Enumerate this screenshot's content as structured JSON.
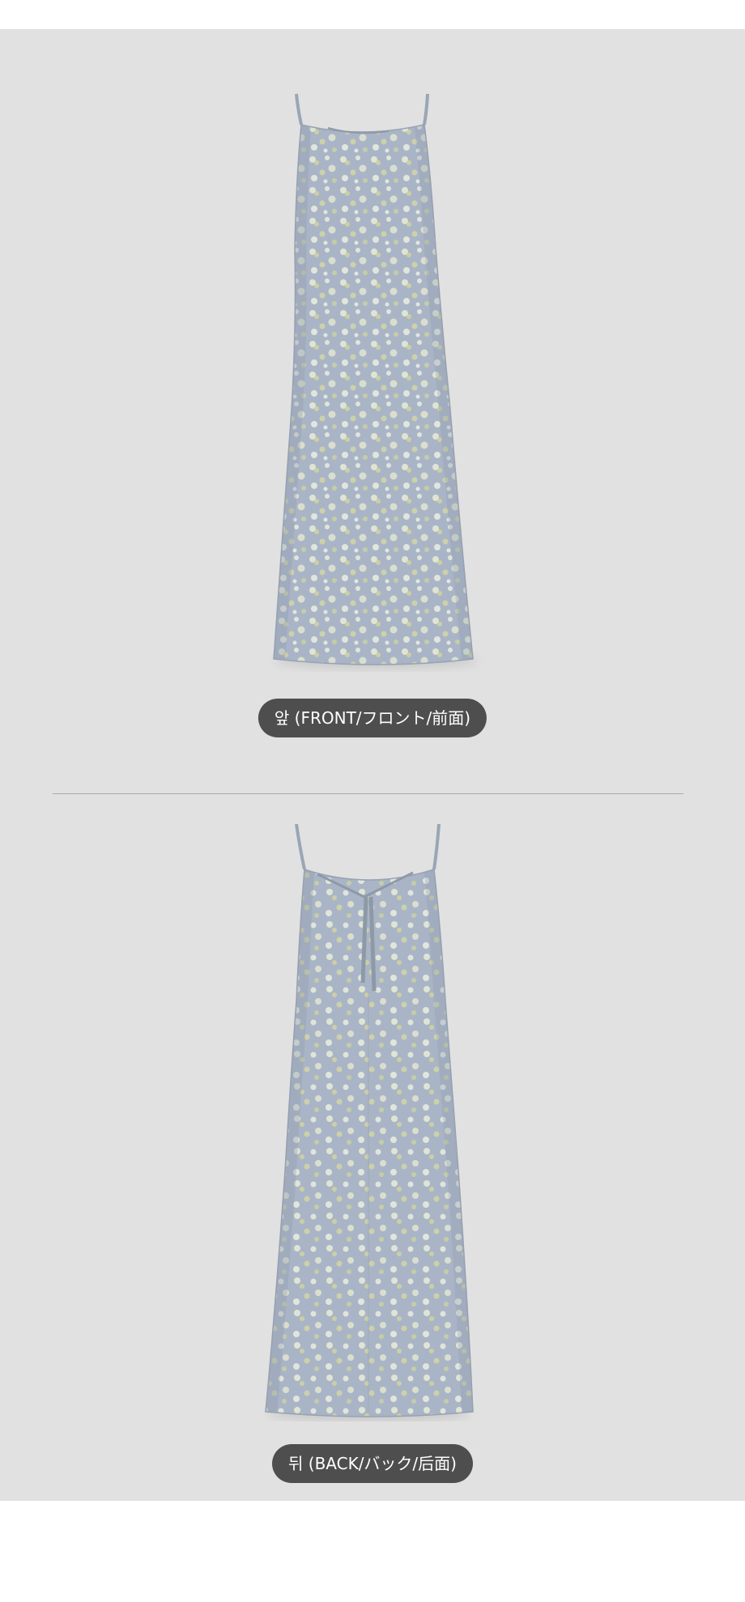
{
  "views": [
    {
      "label": "앞 (FRONT/フロント/前面)",
      "icon": "dress-front-photo"
    },
    {
      "label": "뒤 (BACK/バック/后面)",
      "icon": "dress-back-photo"
    }
  ],
  "colors": {
    "panel_background": "#e1e1e1",
    "label_background": "#4e4e4e",
    "label_text": "#ffffff",
    "dress_base": "#a9b5c6",
    "print_light": "#e9ecd6",
    "print_yellow": "#d4d69a"
  }
}
